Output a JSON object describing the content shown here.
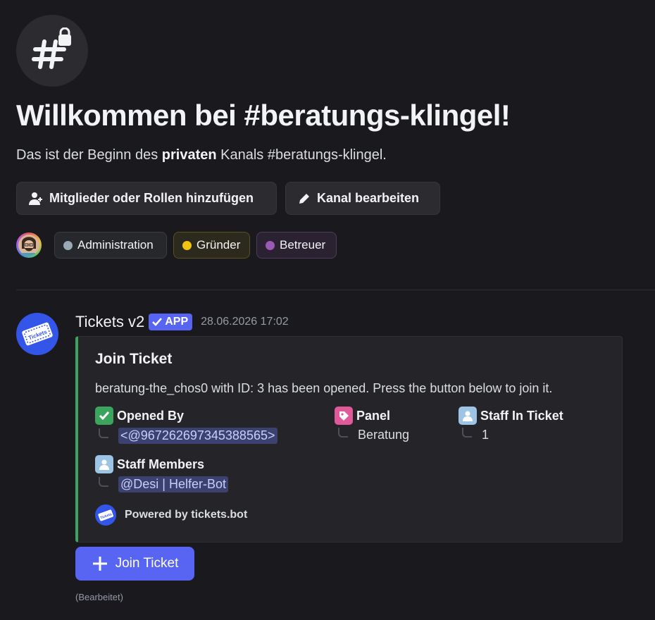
{
  "header": {
    "icon": "hashtag-lock-icon",
    "title": "Willkommen bei #beratungs-klingel!",
    "subtitle_pre": "Das ist der Beginn des ",
    "subtitle_bold": "privaten",
    "subtitle_post": " Kanals #beratungs-klingel."
  },
  "actions": {
    "add_members_label": "Mitglieder oder Rollen hinzufügen",
    "edit_channel_label": "Kanal bearbeiten"
  },
  "roles": [
    {
      "label": "Administration",
      "color": "#99aab5"
    },
    {
      "label": "Gründer",
      "color": "#f1c40f"
    },
    {
      "label": "Betreuer",
      "color": "#9b59b6"
    }
  ],
  "message": {
    "author": "Tickets v2",
    "badge": "APP",
    "timestamp": "28.06.2026 17:02",
    "edited_label": "(Bearbeitet)",
    "embed": {
      "accent_color": "#3ba55d",
      "title": "Join Ticket",
      "description": "beratung-the_chos0 with ID: 3 has been opened. Press the button below to join it.",
      "fields": [
        {
          "name": "Opened By",
          "value": "<@967262697345388565>",
          "icon": "green-check-icon"
        },
        {
          "name": "Panel",
          "value": "Beratung",
          "icon": "pink-tag-icon"
        },
        {
          "name": "Staff In Ticket",
          "value": "1",
          "icon": "staff-icon"
        },
        {
          "name": "Staff Members",
          "value": "@Desi | Helfer-Bot",
          "icon": "staff-icon"
        }
      ],
      "footer": "Powered by tickets.bot"
    },
    "button_label": "Join Ticket"
  }
}
